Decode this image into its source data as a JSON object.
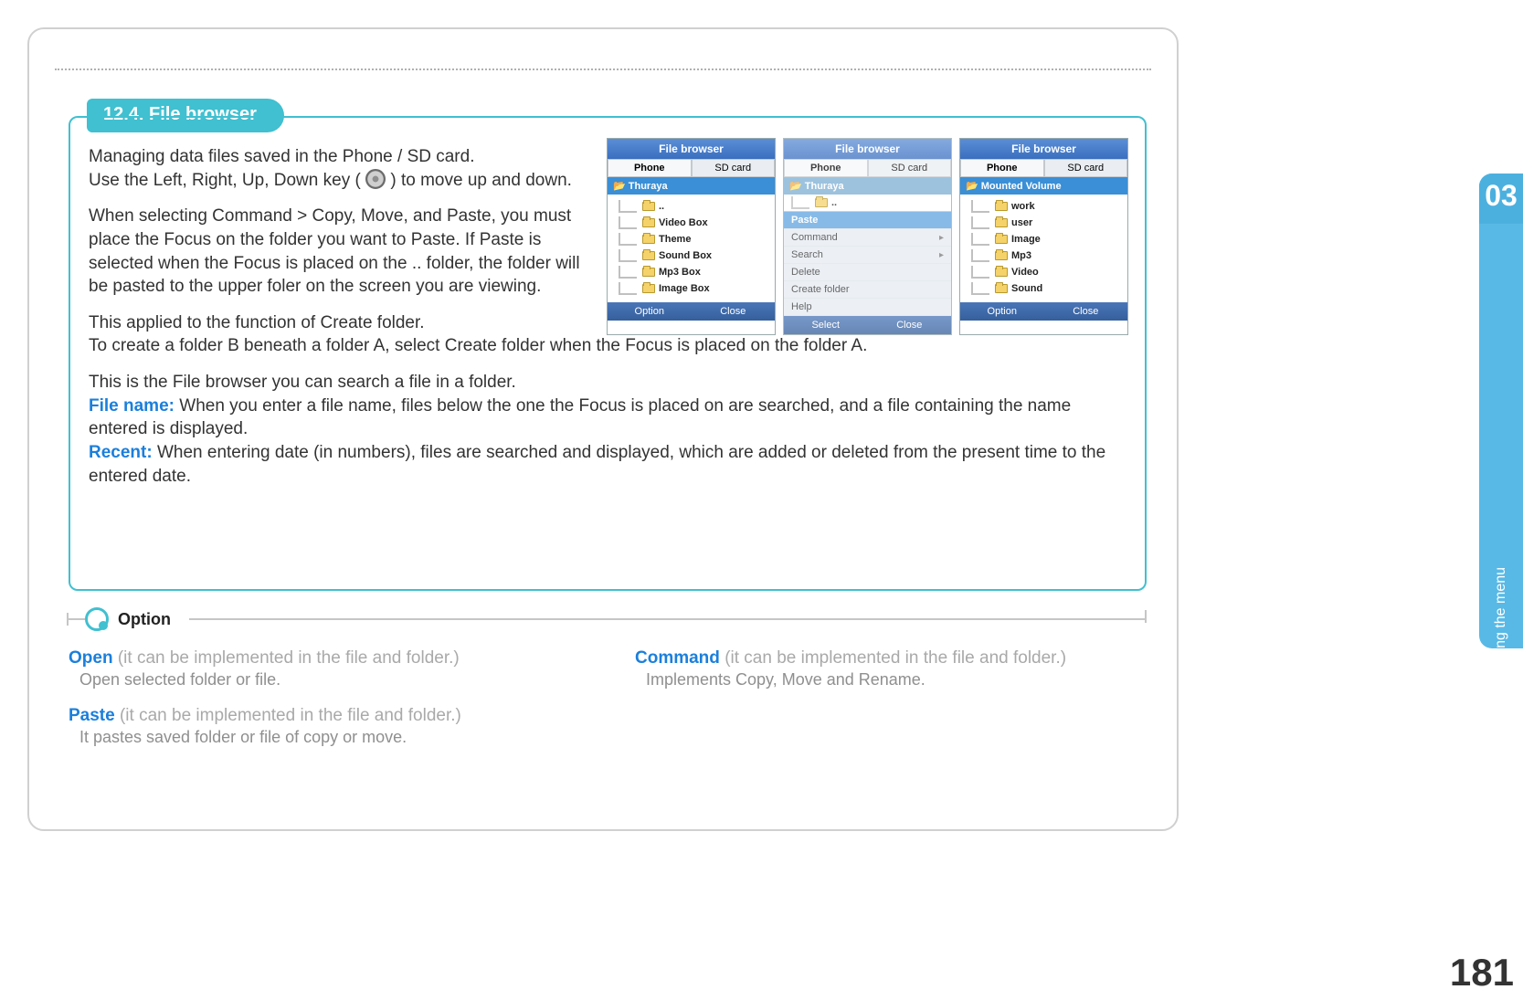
{
  "section": {
    "heading": "12.4. File browser",
    "para1_a": "Managing data files saved in the Phone / SD card.",
    "para1_b_pre": "Use the Left, Right, Up, Down key ( ",
    "para1_b_post": " ) to move up and down.",
    "para2": "When selecting Command > Copy, Move, and Paste, you must place the Focus on the folder you want to Paste. If Paste is selected when the Focus is placed on the .. folder, the folder will be pasted to the upper foler on the screen you are viewing.",
    "para3": "This applied to the function of Create folder.\n To create a folder B beneath a folder A, select Create folder when the Focus is placed on the folder A.",
    "para4_intro": "This is the File browser you can search a file in a folder.",
    "file_name_label": "File name:",
    "file_name_text": " When you enter a file name, files below the one the Focus is placed on are searched, and a file containing the name entered is displayed.",
    "recent_label": "Recent:",
    "recent_text": " When entering date (in numbers), files are searched and displayed, which are added or deleted from the present time to the entered date."
  },
  "screens": [
    {
      "title": "File browser",
      "tabs": [
        "Phone",
        "SD card"
      ],
      "active_tab": 0,
      "root": "Thuraya",
      "items": [
        "..",
        "Video Box",
        "Theme",
        "Sound Box",
        "Mp3 Box",
        "Image Box"
      ],
      "soft": [
        "Option",
        "Close"
      ],
      "faded": false
    },
    {
      "title": "File browser",
      "tabs": [
        "Phone",
        "SD card"
      ],
      "active_tab": 0,
      "root": "Thuraya",
      "upitem": "..",
      "menu": [
        {
          "label": "Paste",
          "hl": true
        },
        {
          "label": "Command",
          "arrow": true
        },
        {
          "label": "Search",
          "arrow": true
        },
        {
          "label": "Delete"
        },
        {
          "label": "Create folder"
        },
        {
          "label": "Help"
        }
      ],
      "soft": [
        "Select",
        "Close"
      ],
      "faded": true
    },
    {
      "title": "File browser",
      "tabs": [
        "Phone",
        "SD card"
      ],
      "active_tab": 0,
      "root": "Mounted Volume",
      "items": [
        "work",
        "user",
        "Image",
        "Mp3",
        "Video",
        "Sound"
      ],
      "soft": [
        "Option",
        "Close"
      ],
      "faded": false
    }
  ],
  "option": {
    "title": "Option",
    "items": [
      {
        "name": "Open",
        "qual": "(it can be implemented in the file and folder.)",
        "desc": "Open selected folder or file."
      },
      {
        "name": "Command",
        "qual": "(it can be implemented in the file and folder.)",
        "desc": "Implements Copy, Move and Rename."
      },
      {
        "name": "Paste",
        "qual": "(it can be implemented in the file and folder.)",
        "desc": "It pastes saved folder or file of copy or move."
      }
    ]
  },
  "side": {
    "num": "03",
    "label": "Using the menu"
  },
  "page_number": "181"
}
